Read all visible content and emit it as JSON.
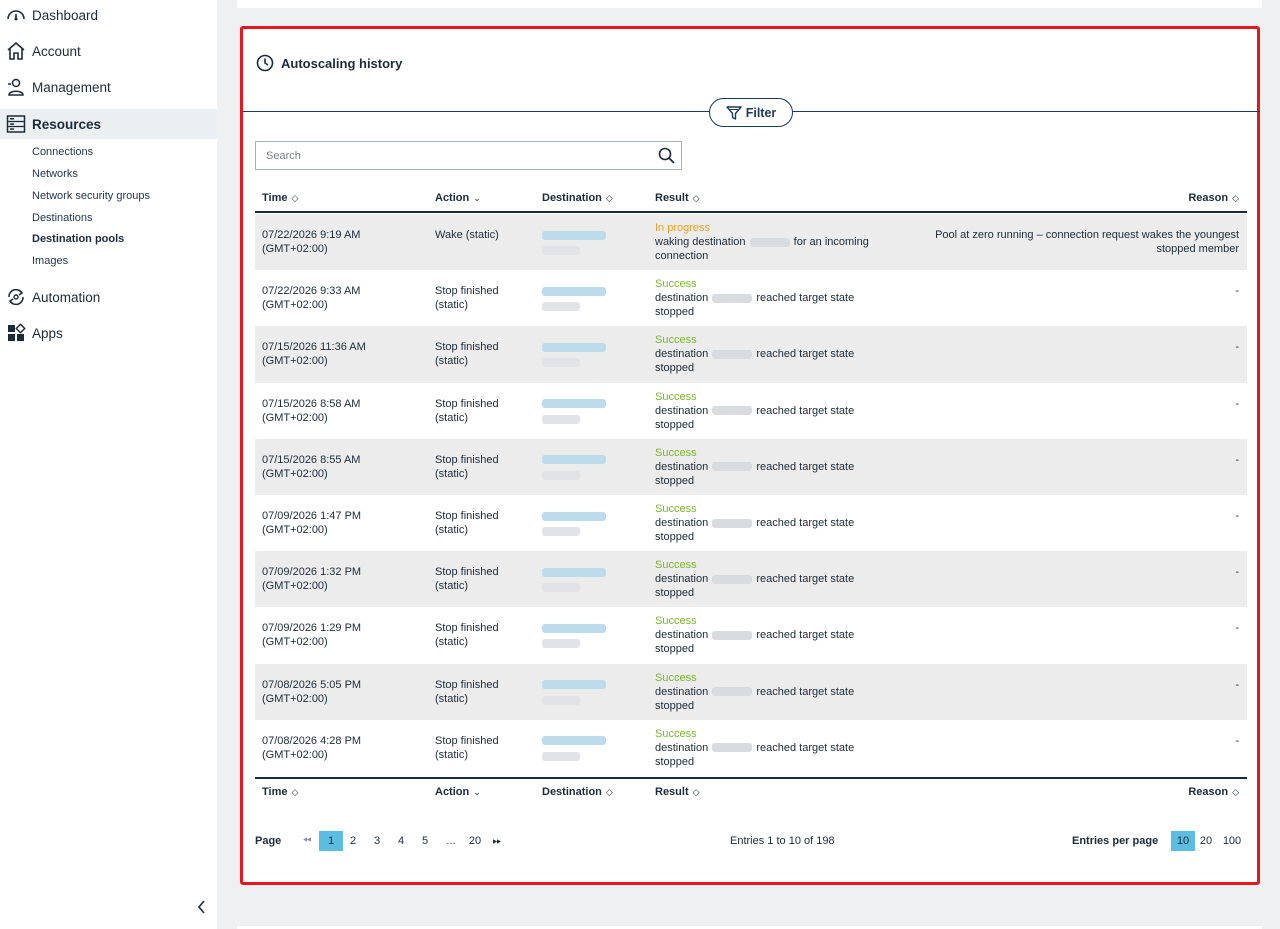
{
  "sidebar": {
    "items": [
      {
        "label": "Dashboard",
        "icon": "gauge-icon"
      },
      {
        "label": "Account",
        "icon": "home-icon"
      },
      {
        "label": "Management",
        "icon": "users-icon"
      },
      {
        "label": "Resources",
        "icon": "server-icon"
      },
      {
        "label": "Automation",
        "icon": "automation-icon"
      },
      {
        "label": "Apps",
        "icon": "apps-icon"
      }
    ],
    "sub_items": [
      "Connections",
      "Networks",
      "Network security groups",
      "Destinations",
      "Destination pools",
      "Images"
    ],
    "active_item": "Resources",
    "active_sub_item": "Destination pools"
  },
  "panel": {
    "title": "Autoscaling history",
    "filter_label": "Filter",
    "search_placeholder": "Search"
  },
  "table": {
    "columns": [
      "Time",
      "Action",
      "Destination",
      "Result",
      "Reason"
    ],
    "rows": [
      {
        "time": "07/22/2026 9:19 AM",
        "tz": "(GMT+02:00)",
        "action": "Wake (static)",
        "status": "In progress",
        "status_type": "progress",
        "result_pre": "waking destination",
        "result_post": "for an incoming connection",
        "reason": "Pool at zero running – connection request wakes the youngest stopped member"
      },
      {
        "time": "07/22/2026 9:33 AM",
        "tz": "(GMT+02:00)",
        "action": "Stop finished (static)",
        "status": "Success",
        "status_type": "success",
        "result_pre": "destination",
        "result_post": "reached target state stopped",
        "reason": "-"
      },
      {
        "time": "07/15/2026 11:36 AM",
        "tz": "(GMT+02:00)",
        "action": "Stop finished (static)",
        "status": "Success",
        "status_type": "success",
        "result_pre": "destination",
        "result_post": "reached target state stopped",
        "reason": "-"
      },
      {
        "time": "07/15/2026 8:58 AM",
        "tz": "(GMT+02:00)",
        "action": "Stop finished (static)",
        "status": "Success",
        "status_type": "success",
        "result_pre": "destination",
        "result_post": "reached target state stopped",
        "reason": "-"
      },
      {
        "time": "07/15/2026 8:55 AM",
        "tz": "(GMT+02:00)",
        "action": "Stop finished (static)",
        "status": "Success",
        "status_type": "success",
        "result_pre": "destination",
        "result_post": "reached target state stopped",
        "reason": "-"
      },
      {
        "time": "07/09/2026 1:47 PM",
        "tz": "(GMT+02:00)",
        "action": "Stop finished (static)",
        "status": "Success",
        "status_type": "success",
        "result_pre": "destination",
        "result_post": "reached target state stopped",
        "reason": "-"
      },
      {
        "time": "07/09/2026 1:32 PM",
        "tz": "(GMT+02:00)",
        "action": "Stop finished (static)",
        "status": "Success",
        "status_type": "success",
        "result_pre": "destination",
        "result_post": "reached target state stopped",
        "reason": "-"
      },
      {
        "time": "07/09/2026 1:29 PM",
        "tz": "(GMT+02:00)",
        "action": "Stop finished (static)",
        "status": "Success",
        "status_type": "success",
        "result_pre": "destination",
        "result_post": "reached target state stopped",
        "reason": "-"
      },
      {
        "time": "07/08/2026 5:05 PM",
        "tz": "(GMT+02:00)",
        "action": "Stop finished (static)",
        "status": "Success",
        "status_type": "success",
        "result_pre": "destination",
        "result_post": "reached target state stopped",
        "reason": "-"
      },
      {
        "time": "07/08/2026 4:28 PM",
        "tz": "(GMT+02:00)",
        "action": "Stop finished (static)",
        "status": "Success",
        "status_type": "success",
        "result_pre": "destination",
        "result_post": "reached target state stopped",
        "reason": "-"
      }
    ]
  },
  "pagination": {
    "label": "Page",
    "pages": [
      "1",
      "2",
      "3",
      "4",
      "5",
      "...",
      "20"
    ],
    "current": "1",
    "entries_text": "Entries 1 to 10 of 198",
    "per_page_label": "Entries per page",
    "per_page_options": [
      "10",
      "20",
      "100"
    ],
    "per_page_selected": "10"
  },
  "colors": {
    "accent": "#5bbde0",
    "success": "#7ab62a",
    "in_progress": "#f0a020",
    "highlight_border": "#e8161e",
    "navy": "#1c3a5a"
  }
}
